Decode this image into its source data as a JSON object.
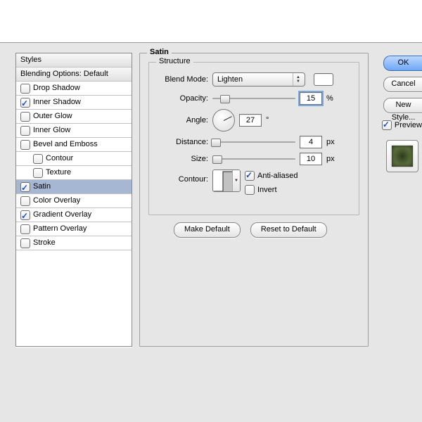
{
  "sidebar": {
    "header": "Styles",
    "blending_header": "Blending Options: Default",
    "items": [
      {
        "label": "Drop Shadow",
        "checked": false
      },
      {
        "label": "Inner Shadow",
        "checked": true
      },
      {
        "label": "Outer Glow",
        "checked": false
      },
      {
        "label": "Inner Glow",
        "checked": false
      },
      {
        "label": "Bevel and Emboss",
        "checked": false
      },
      {
        "label": "Contour",
        "checked": false,
        "indent": true
      },
      {
        "label": "Texture",
        "checked": false,
        "indent": true
      },
      {
        "label": "Satin",
        "checked": true,
        "selected": true
      },
      {
        "label": "Color Overlay",
        "checked": false
      },
      {
        "label": "Gradient Overlay",
        "checked": true
      },
      {
        "label": "Pattern Overlay",
        "checked": false
      },
      {
        "label": "Stroke",
        "checked": false
      }
    ]
  },
  "panel": {
    "title": "Satin",
    "structure_title": "Structure",
    "blend_mode_label": "Blend Mode:",
    "blend_mode_value": "Lighten",
    "opacity_label": "Opacity:",
    "opacity_value": "15",
    "opacity_unit": "%",
    "angle_label": "Angle:",
    "angle_value": "27",
    "angle_unit": "°",
    "angle_deg": 27,
    "distance_label": "Distance:",
    "distance_value": "4",
    "distance_unit": "px",
    "size_label": "Size:",
    "size_value": "10",
    "size_unit": "px",
    "contour_label": "Contour:",
    "anti_aliased_label": "Anti-aliased",
    "anti_aliased_checked": true,
    "invert_label": "Invert",
    "invert_checked": false,
    "make_default_label": "Make Default",
    "reset_default_label": "Reset to Default",
    "opacity_pct": 15,
    "distance_pct": 4,
    "size_pct": 6
  },
  "right": {
    "ok": "OK",
    "cancel": "Cancel",
    "new_style": "New Style...",
    "preview_label": "Preview",
    "preview_checked": true
  }
}
